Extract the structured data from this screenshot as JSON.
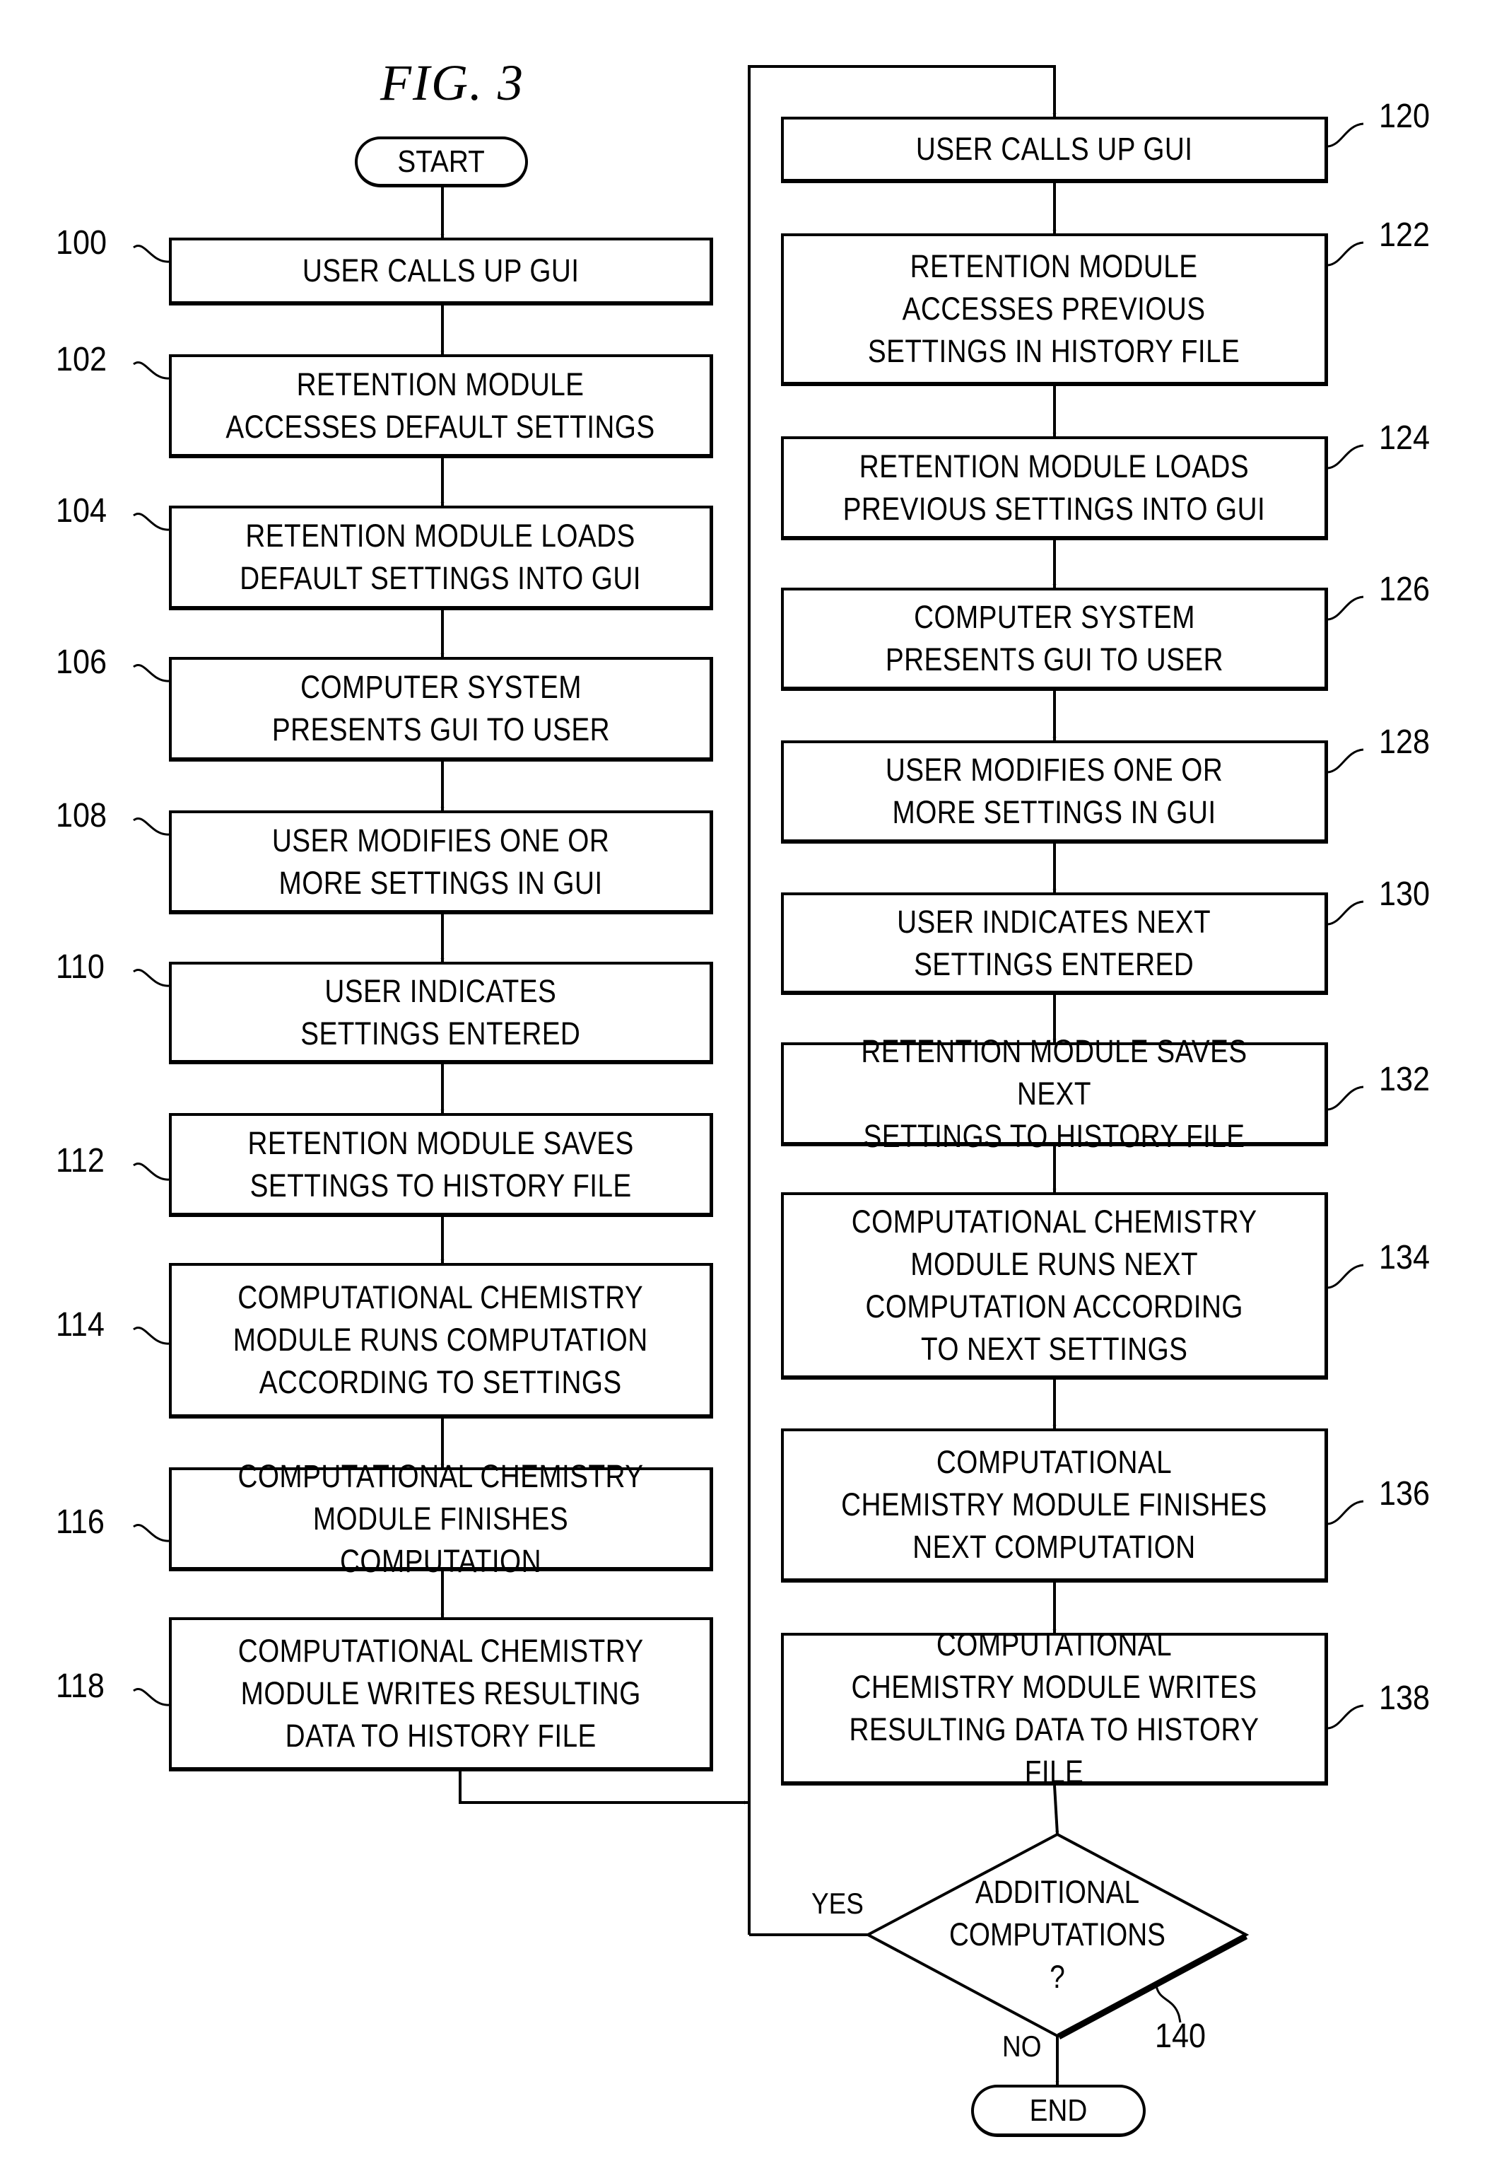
{
  "figure": {
    "title": "FIG. 3",
    "start_label": "START",
    "end_label": "END"
  },
  "left_steps": [
    {
      "ref": "100",
      "text": "USER CALLS UP GUI"
    },
    {
      "ref": "102",
      "text": "RETENTION MODULE\nACCESSES DEFAULT SETTINGS"
    },
    {
      "ref": "104",
      "text": "RETENTION MODULE LOADS\nDEFAULT SETTINGS INTO GUI"
    },
    {
      "ref": "106",
      "text": "COMPUTER SYSTEM\nPRESENTS GUI TO USER"
    },
    {
      "ref": "108",
      "text": "USER MODIFIES ONE OR\nMORE SETTINGS IN GUI"
    },
    {
      "ref": "110",
      "text": "USER INDICATES\nSETTINGS ENTERED"
    },
    {
      "ref": "112",
      "text": "RETENTION MODULE SAVES\nSETTINGS TO HISTORY FILE"
    },
    {
      "ref": "114",
      "text": "COMPUTATIONAL CHEMISTRY\nMODULE RUNS COMPUTATION\nACCORDING TO SETTINGS"
    },
    {
      "ref": "116",
      "text": "COMPUTATIONAL CHEMISTRY\nMODULE FINISHES COMPUTATION"
    },
    {
      "ref": "118",
      "text": "COMPUTATIONAL CHEMISTRY\nMODULE WRITES RESULTING\nDATA TO HISTORY FILE"
    }
  ],
  "right_steps": [
    {
      "ref": "120",
      "text": "USER CALLS UP GUI"
    },
    {
      "ref": "122",
      "text": "RETENTION MODULE\nACCESSES PREVIOUS\nSETTINGS IN HISTORY FILE"
    },
    {
      "ref": "124",
      "text": "RETENTION MODULE LOADS\nPREVIOUS SETTINGS INTO GUI"
    },
    {
      "ref": "126",
      "text": "COMPUTER SYSTEM\nPRESENTS GUI TO USER"
    },
    {
      "ref": "128",
      "text": "USER MODIFIES ONE OR\nMORE SETTINGS IN GUI"
    },
    {
      "ref": "130",
      "text": "USER INDICATES NEXT\nSETTINGS ENTERED"
    },
    {
      "ref": "132",
      "text": "RETENTION MODULE SAVES NEXT\nSETTINGS TO HISTORY FILE"
    },
    {
      "ref": "134",
      "text": "COMPUTATIONAL CHEMISTRY\nMODULE RUNS NEXT\nCOMPUTATION ACCORDING\nTO NEXT SETTINGS"
    },
    {
      "ref": "136",
      "text": "COMPUTATIONAL\nCHEMISTRY MODULE FINISHES\nNEXT COMPUTATION"
    },
    {
      "ref": "138",
      "text": "COMPUTATIONAL\nCHEMISTRY MODULE WRITES\nRESULTING DATA TO HISTORY FILE"
    }
  ],
  "decision": {
    "ref": "140",
    "lines": [
      "ADDITIONAL",
      "COMPUTATIONS",
      "?"
    ],
    "yes_label": "YES",
    "no_label": "NO"
  }
}
